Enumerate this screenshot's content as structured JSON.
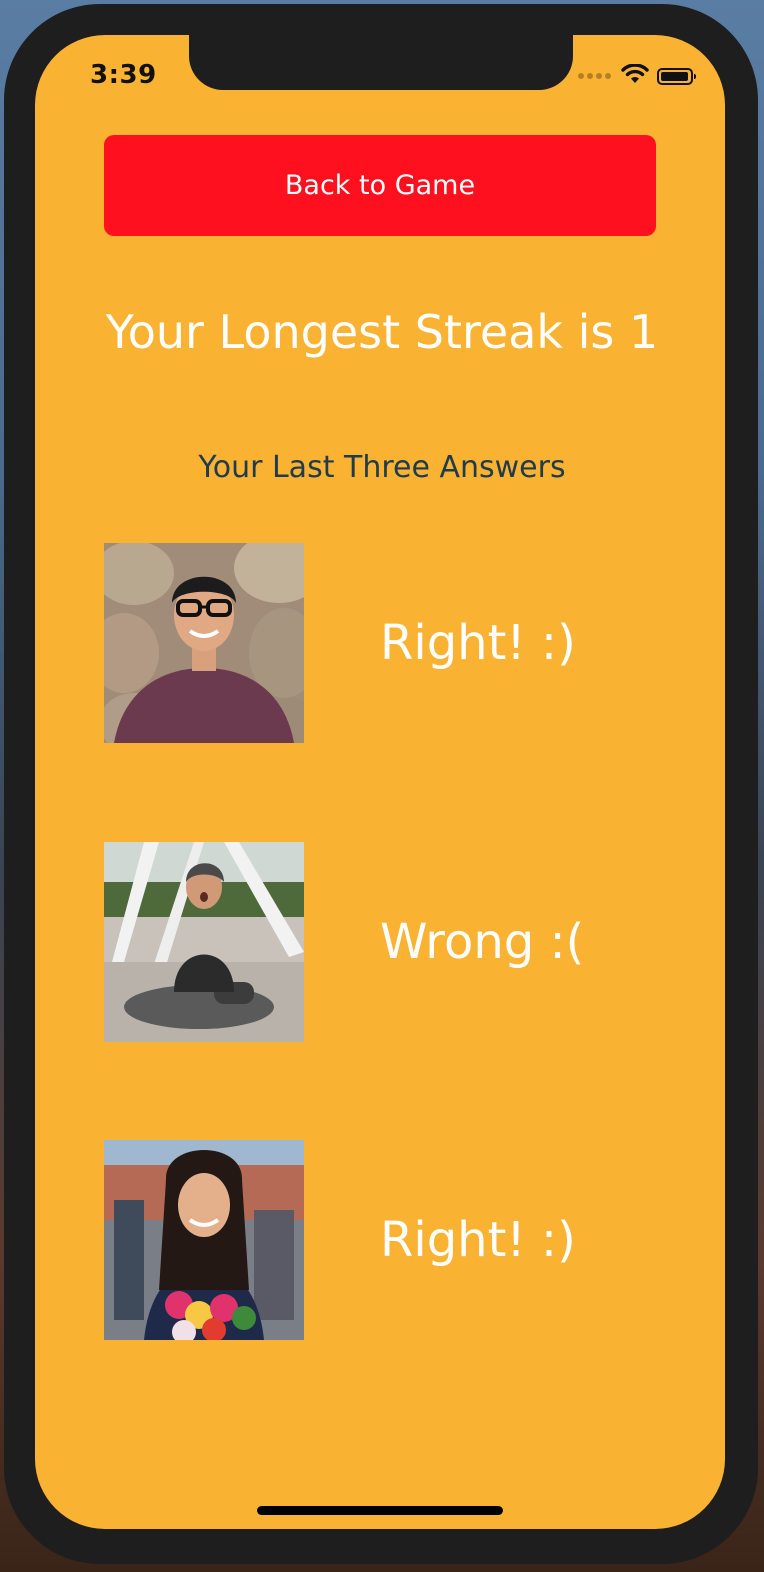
{
  "status_bar": {
    "time": "3:39"
  },
  "back_button_label": "Back to Game",
  "streak_title": "Your Longest Streak is 1",
  "last_answers_title": "Your Last Three Answers",
  "answers": [
    {
      "result": "Right! :)",
      "photo_icon": "portrait-photo"
    },
    {
      "result": "Wrong :(",
      "photo_icon": "portrait-photo"
    },
    {
      "result": "Right! :)",
      "photo_icon": "portrait-photo"
    }
  ],
  "colors": {
    "background": "#f9b232",
    "button": "#ff101e",
    "subtitle": "#1f3b4d",
    "text": "#ffffff"
  }
}
